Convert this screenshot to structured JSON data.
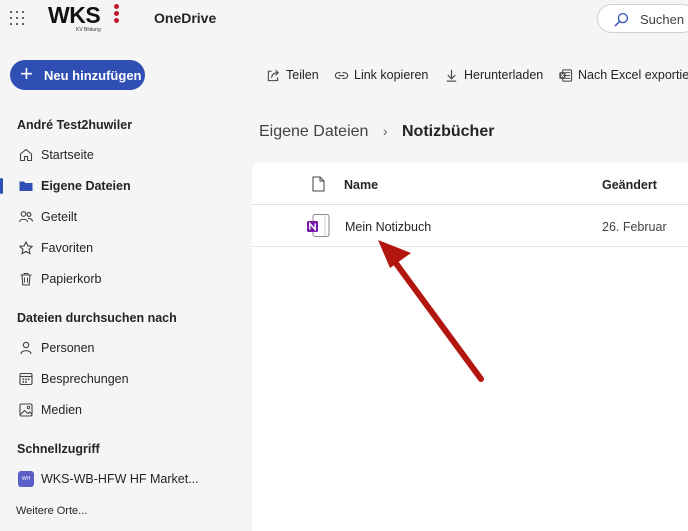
{
  "header": {
    "logo_text": "WKS",
    "logo_subtitle": "KV Bildung",
    "app_name": "OneDrive",
    "search_label": "Suchen"
  },
  "sidebar": {
    "new_button": "Neu hinzufügen",
    "user_name": "André Test2huwiler",
    "main_items": [
      {
        "label": "Startseite",
        "icon": "home-icon"
      },
      {
        "label": "Eigene Dateien",
        "icon": "folder-icon",
        "active": true
      },
      {
        "label": "Geteilt",
        "icon": "people-icon"
      },
      {
        "label": "Favoriten",
        "icon": "star-icon"
      },
      {
        "label": "Papierkorb",
        "icon": "trash-icon"
      }
    ],
    "browse_title": "Dateien durchsuchen nach",
    "browse_items": [
      {
        "label": "Personen",
        "icon": "person-icon"
      },
      {
        "label": "Besprechungen",
        "icon": "calendar-icon"
      },
      {
        "label": "Medien",
        "icon": "image-icon"
      }
    ],
    "quick_title": "Schnellzugriff",
    "quick_items": [
      {
        "label": "WKS-WB-HFW HF Market...",
        "badge": "WH"
      }
    ],
    "more_link": "Weitere Orte..."
  },
  "toolbar": {
    "share": "Teilen",
    "copy_link": "Link kopieren",
    "download": "Herunterladen",
    "export_excel": "Nach Excel exportier"
  },
  "breadcrumb": {
    "root": "Eigene Dateien",
    "separator": "›",
    "current": "Notizbücher"
  },
  "filelist": {
    "col_name": "Name",
    "col_modified": "Geändert",
    "rows": [
      {
        "name": "Mein Notizbuch",
        "modified": "26. Februar",
        "icon": "onenote-icon"
      }
    ]
  },
  "colors": {
    "accent": "#2f4fb5",
    "onenote": "#7719aa",
    "annotation_arrow": "#b3160f"
  }
}
